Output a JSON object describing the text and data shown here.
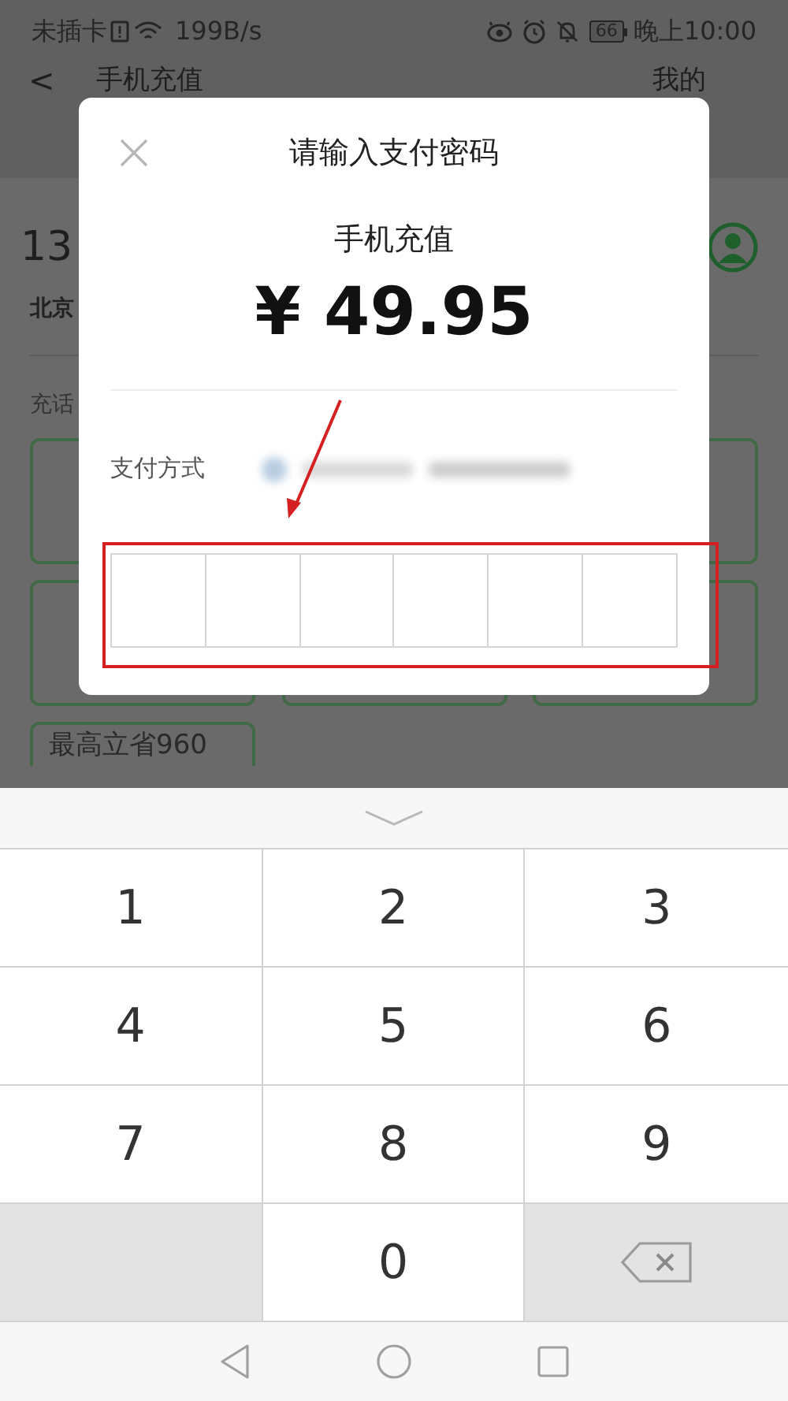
{
  "status_bar": {
    "carrier": "未插卡",
    "speed": "199B/s",
    "battery": "66",
    "time": "晚上10:00"
  },
  "nav_bar": {
    "back": "<",
    "title": "手机充值",
    "right": "我的"
  },
  "background": {
    "phone": "13",
    "region": "北京",
    "section_label": "充话",
    "option_rows": [
      {
        "options": [
          {
            "kind": "card"
          },
          {
            "kind": "card"
          }
        ]
      },
      {
        "options": [
          {
            "kind": "card"
          },
          {
            "kind": "card"
          },
          {
            "kind": "card"
          }
        ]
      },
      {
        "options": [
          {
            "kind": "card",
            "text": "最高立省960"
          }
        ]
      }
    ]
  },
  "dialog": {
    "title": "请输入支付密码",
    "product": "手机充值",
    "amount": "¥ 49.95",
    "payment_label": "支付方式",
    "password_cells": [
      {
        "filled": false
      },
      {
        "filled": false
      },
      {
        "filled": false
      },
      {
        "filled": false
      },
      {
        "filled": false
      },
      {
        "filled": false
      }
    ]
  },
  "keypad": {
    "keys": [
      {
        "kind": "digit",
        "label": "1"
      },
      {
        "kind": "digit",
        "label": "2"
      },
      {
        "kind": "digit",
        "label": "3"
      },
      {
        "kind": "digit",
        "label": "4"
      },
      {
        "kind": "digit",
        "label": "5"
      },
      {
        "kind": "digit",
        "label": "6"
      },
      {
        "kind": "digit",
        "label": "7"
      },
      {
        "kind": "digit",
        "label": "8"
      },
      {
        "kind": "digit",
        "label": "9"
      },
      {
        "kind": "blank"
      },
      {
        "kind": "digit",
        "label": "0"
      },
      {
        "kind": "backspace"
      }
    ]
  }
}
